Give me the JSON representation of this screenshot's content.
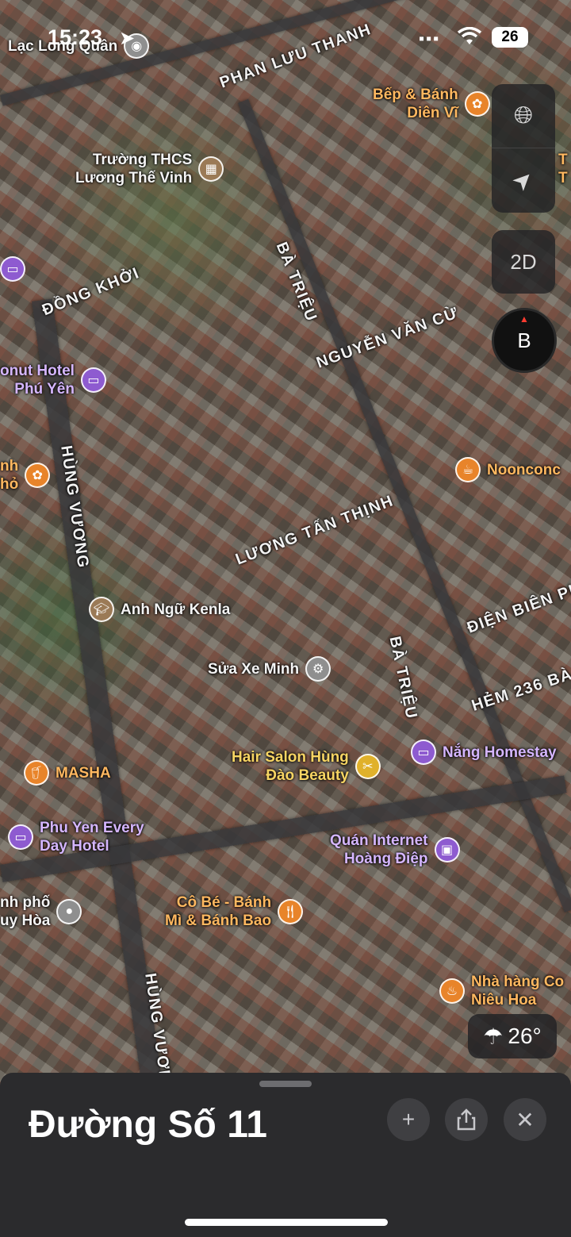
{
  "status_bar": {
    "time": "15:23",
    "battery": "26"
  },
  "map_controls": {
    "view_mode": "2D",
    "compass_letter": "B"
  },
  "streets": [
    "PHAN LƯU THANH",
    "ĐỒNG KHỞI",
    "BÀ TRIỆU",
    "NGUYỄN VĂN CỪ",
    "HÙNG VƯƠNG",
    "LƯƠNG TẤN THỊNH",
    "ĐIỆN BIÊN PHỦ",
    "BÀ TRIỆU",
    "HẺM 236 BÀ",
    "HÙNG VƯƠNG"
  ],
  "pois": [
    {
      "label": "Lạc Long Quân",
      "icon": "landmark-icon",
      "color": "white"
    },
    {
      "label": "Bếp & Bánh\nDiên Vĩ",
      "icon": "bakery-icon",
      "color": "orange"
    },
    {
      "label": "Trường THCS\nLương Thế Vinh",
      "icon": "school-icon",
      "color": "white"
    },
    {
      "label": "onut Hotel\nPhú Yên",
      "icon": "bed-icon",
      "color": "purple"
    },
    {
      "label": "Noonconc",
      "icon": "coffee-icon",
      "color": "orange"
    },
    {
      "label": "Anh Ngữ Kenla",
      "icon": "graduation-cap-icon",
      "color": "white"
    },
    {
      "label": "Sửa Xe Minh",
      "icon": "motorbike-icon",
      "color": "white"
    },
    {
      "label": "Hair Salon Hùng\nĐào Beauty",
      "icon": "scissors-icon",
      "color": "yellow"
    },
    {
      "label": "Nắng Homestay",
      "icon": "bed-icon",
      "color": "purple"
    },
    {
      "label": "MASHA",
      "icon": "drink-icon",
      "color": "orange"
    },
    {
      "label": "Phu Yen Every\nDay Hotel",
      "icon": "bed-icon",
      "color": "purple"
    },
    {
      "label": "Quán Internet\nHoàng Điệp",
      "icon": "computer-icon",
      "color": "purple"
    },
    {
      "label": "nh phố\nuy Hòa",
      "icon": "city-icon",
      "color": "white"
    },
    {
      "label": "Cô Bé - Bánh\nMì & Bánh Bao",
      "icon": "fork-knife-icon",
      "color": "orange"
    },
    {
      "label": "Nhà hàng Co\nNiêu Hoa",
      "icon": "restaurant-icon",
      "color": "orange"
    },
    {
      "label": "nh\nhỏ",
      "icon": "bakery-icon",
      "color": "orange"
    },
    {
      "label": "T\nT",
      "icon": "",
      "color": "white"
    }
  ],
  "weather": {
    "temp": "26°",
    "icon": "rain-cloud-icon"
  },
  "sheet": {
    "title": "Đường Số 11"
  },
  "colors": {
    "accent_orange": "#e8842a",
    "accent_purple": "#8e5bd0",
    "sheet_bg": "#2b2b2d"
  }
}
